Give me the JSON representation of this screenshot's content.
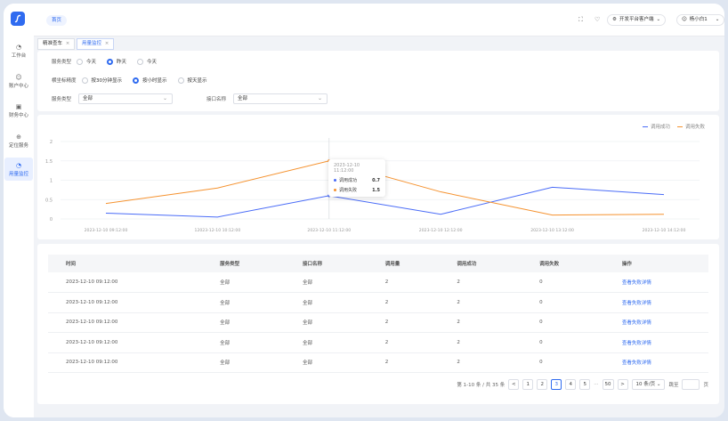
{
  "sidebar": {
    "items": [
      {
        "label": "工作台",
        "icon": "dashboard-icon"
      },
      {
        "label": "账户中心",
        "icon": "user-icon"
      },
      {
        "label": "财务中心",
        "icon": "wallet-icon"
      },
      {
        "label": "定位服务",
        "icon": "location-icon"
      },
      {
        "label": "用量监控",
        "icon": "monitor-icon",
        "active": true
      }
    ]
  },
  "topbar": {
    "home": "首页",
    "platform": "开发平台客户端",
    "user": "杨小白1"
  },
  "tabs": [
    {
      "label": "精准查车",
      "close": "×"
    },
    {
      "label": "用量监控",
      "close": "×",
      "active": true
    }
  ],
  "filters": {
    "service_type_label": "服务类型",
    "service_type_options": [
      "今天",
      "昨天",
      "今天"
    ],
    "granularity_label": "横坐标精度",
    "granularity_options": [
      "按30分钟显示",
      "按小时显示",
      "按天显示"
    ],
    "service_select_label": "服务类型",
    "service_select_value": "全部",
    "api_label": "接口名称",
    "api_value": "全部"
  },
  "chart_data": {
    "type": "line",
    "x": [
      "2023-12-10 09:12:00",
      "2023-12-10 10:12:00",
      "2023-12-10 11:12:00",
      "2023-12-10 12:12:00",
      "2023-12-10 13:12:00",
      "2023-12-10 14:12:00"
    ],
    "x_tick_labels": [
      "2023-12-10 09:12:00",
      "12023-12-10 10:12:00",
      "2023-12-10 11:12:00",
      "2023-12-10 12:12:00",
      "2023-12-10 13:12:00",
      "2023-12-10 14:12:00"
    ],
    "series": [
      {
        "name": "调用成功",
        "color": "#4a6cf7",
        "values": [
          0.15,
          0.05,
          0.6,
          0.12,
          0.82,
          0.63
        ]
      },
      {
        "name": "调用失败",
        "color": "#f5922f",
        "values": [
          0.4,
          0.8,
          1.5,
          0.7,
          0.1,
          0.12
        ]
      }
    ],
    "y_ticks": [
      "2",
      "1.5",
      "1",
      "0.5",
      "0"
    ],
    "ylim": [
      0,
      2
    ],
    "legend_position": "top-right",
    "tooltip": {
      "title": "2023-12-10 11:12:00",
      "rows": [
        {
          "name": "调用成功",
          "value": "0.7"
        },
        {
          "name": "调用失败",
          "value": "1.5"
        }
      ]
    }
  },
  "table": {
    "columns": [
      "时间",
      "服务类型",
      "接口名称",
      "调用量",
      "调用成功",
      "调用失败",
      "操作"
    ],
    "rows": [
      [
        "2023-12-10 09:12:00",
        "全部",
        "全部",
        "2",
        "2",
        "0",
        "查看失败详情"
      ],
      [
        "2023-12-10 09:12:00",
        "全部",
        "全部",
        "2",
        "2",
        "0",
        "查看失败详情"
      ],
      [
        "2023-12-10 09:12:00",
        "全部",
        "全部",
        "2",
        "2",
        "0",
        "查看失败详情"
      ],
      [
        "2023-12-10 09:12:00",
        "全部",
        "全部",
        "2",
        "2",
        "0",
        "查看失败详情"
      ],
      [
        "2023-12-10 09:12:00",
        "全部",
        "全部",
        "2",
        "2",
        "0",
        "查看失败详情"
      ]
    ]
  },
  "pagination": {
    "summary": "第 1-10 条 / 共 35 条",
    "prev": "<",
    "pages": [
      "1",
      "2",
      "3",
      "4",
      "5"
    ],
    "ellipsis": "···",
    "last": "50",
    "next": ">",
    "page_size": "10 条/页",
    "jump_label": "跳至",
    "page_unit": "页",
    "current_page": 3
  }
}
